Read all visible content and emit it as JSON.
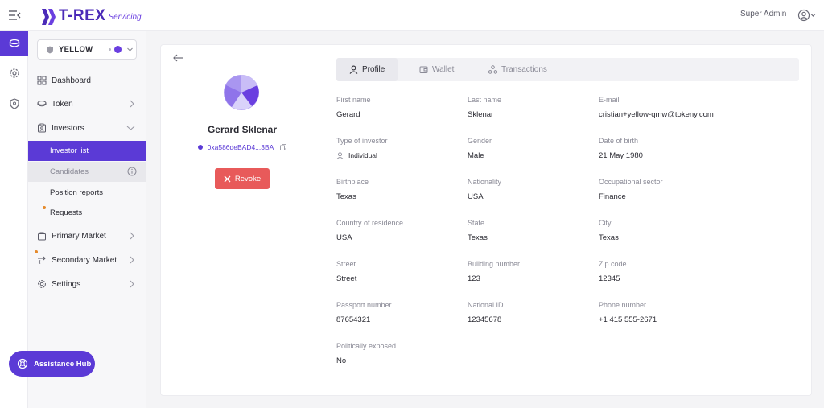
{
  "header": {
    "logo_text": "T-REX",
    "logo_sub": "Servicing",
    "user_name": "Super Admin"
  },
  "org_selector": {
    "name": "YELLOW"
  },
  "sidebar": {
    "items": [
      {
        "label": "Dashboard",
        "icon": "dashboard-icon"
      },
      {
        "label": "Token",
        "icon": "token-icon"
      },
      {
        "label": "Investors",
        "icon": "investors-icon"
      },
      {
        "label": "Primary Market",
        "icon": "primary-market-icon"
      },
      {
        "label": "Secondary Market",
        "icon": "secondary-market-icon"
      },
      {
        "label": "Settings",
        "icon": "settings-icon"
      }
    ],
    "investor_subitems": [
      {
        "label": "Investor list",
        "state": "active"
      },
      {
        "label": "Candidates",
        "state": "muted"
      },
      {
        "label": "Position reports",
        "state": "normal"
      },
      {
        "label": "Requests",
        "state": "normal"
      }
    ],
    "assistance_label": "Assistance Hub"
  },
  "profile": {
    "name": "Gerard Sklenar",
    "wallet": "0xa586deBAD4...3BA",
    "revoke_label": "Revoke"
  },
  "tabs": [
    {
      "label": "Profile",
      "active": true
    },
    {
      "label": "Wallet",
      "active": false
    },
    {
      "label": "Transactions",
      "active": false
    }
  ],
  "fields": {
    "first_name": {
      "label": "First name",
      "value": "Gerard"
    },
    "last_name": {
      "label": "Last name",
      "value": "Sklenar"
    },
    "email": {
      "label": "E-mail",
      "value": "cristian+yellow-qmw@tokeny.com"
    },
    "investor_type": {
      "label": "Type of investor",
      "value": "Individual"
    },
    "gender": {
      "label": "Gender",
      "value": "Male"
    },
    "dob": {
      "label": "Date of birth",
      "value": "21 May 1980"
    },
    "birthplace": {
      "label": "Birthplace",
      "value": "Texas"
    },
    "nationality": {
      "label": "Nationality",
      "value": "USA"
    },
    "occupation": {
      "label": "Occupational sector",
      "value": "Finance"
    },
    "residence": {
      "label": "Country of residence",
      "value": "USA"
    },
    "state": {
      "label": "State",
      "value": "Texas"
    },
    "city": {
      "label": "City",
      "value": "Texas"
    },
    "street": {
      "label": "Street",
      "value": "Street"
    },
    "building": {
      "label": "Building number",
      "value": "123"
    },
    "zip": {
      "label": "Zip code",
      "value": "12345"
    },
    "passport": {
      "label": "Passport number",
      "value": "87654321"
    },
    "national_id": {
      "label": "National ID",
      "value": "12345678"
    },
    "phone": {
      "label": "Phone number",
      "value": "+1 415 555-2671"
    },
    "pep": {
      "label": "Politically exposed",
      "value": "No"
    }
  },
  "colors": {
    "accent": "#5b3ad6",
    "danger": "#e85a5a",
    "notification": "#e58a2b"
  }
}
